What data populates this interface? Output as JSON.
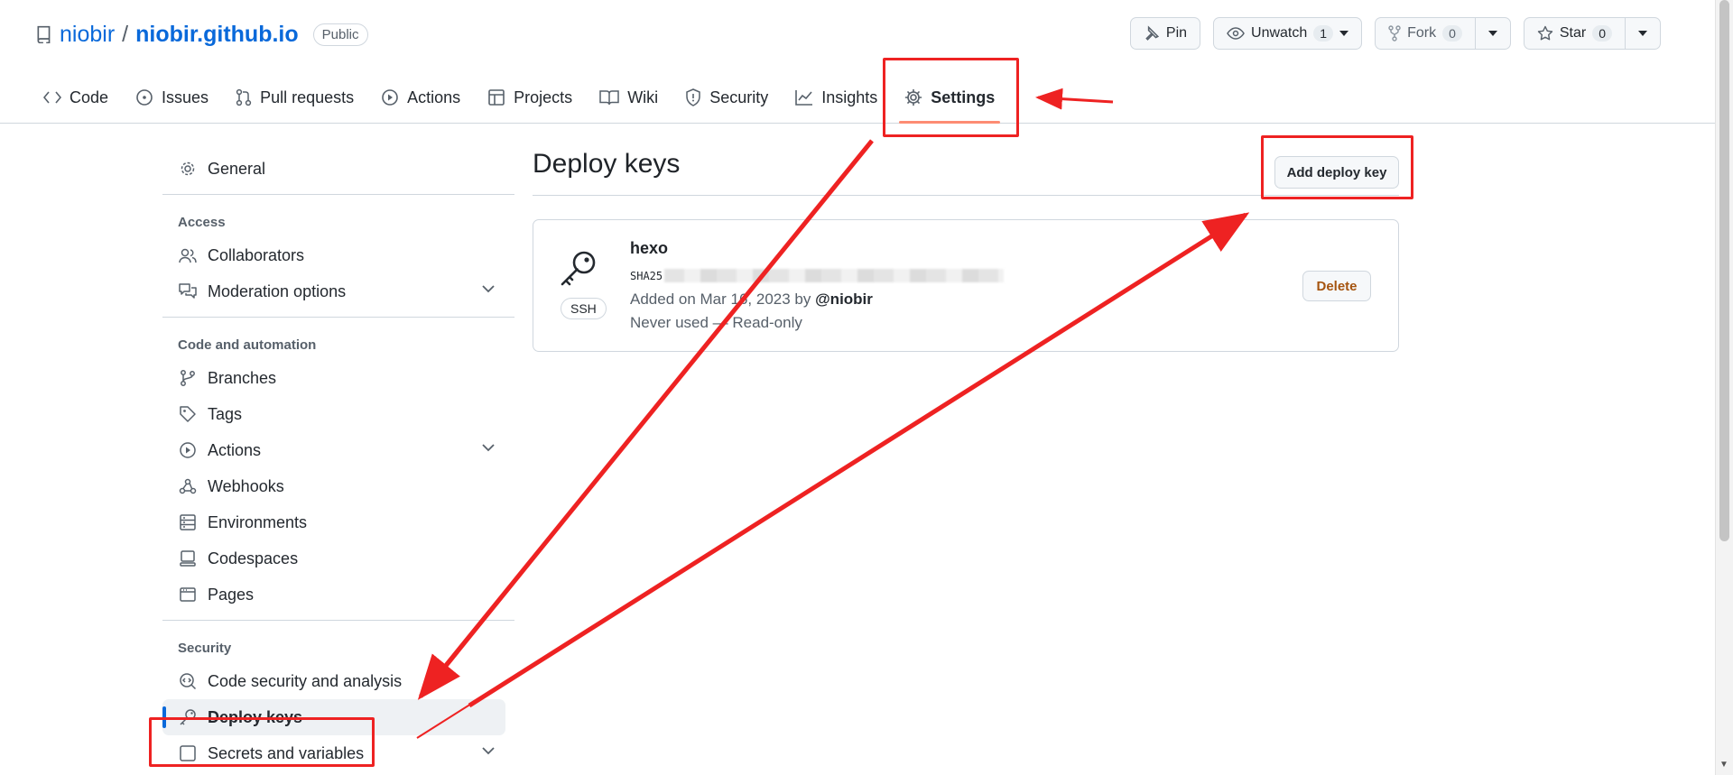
{
  "repo": {
    "owner": "niobir",
    "separator": "/",
    "name": "niobir.github.io",
    "visibility": "Public"
  },
  "repo_actions": {
    "pin": "Pin",
    "unwatch": "Unwatch",
    "watch_count": "1",
    "fork": "Fork",
    "fork_count": "0",
    "star": "Star",
    "star_count": "0"
  },
  "tabs": [
    {
      "label": "Code",
      "icon": "code-icon"
    },
    {
      "label": "Issues",
      "icon": "issue-icon"
    },
    {
      "label": "Pull requests",
      "icon": "pull-request-icon"
    },
    {
      "label": "Actions",
      "icon": "play-icon"
    },
    {
      "label": "Projects",
      "icon": "table-icon"
    },
    {
      "label": "Wiki",
      "icon": "book-icon"
    },
    {
      "label": "Security",
      "icon": "shield-icon"
    },
    {
      "label": "Insights",
      "icon": "graph-icon"
    },
    {
      "label": "Settings",
      "icon": "gear-icon",
      "selected": true
    }
  ],
  "sidebar": {
    "general": "General",
    "access_heading": "Access",
    "collaborators": "Collaborators",
    "moderation": "Moderation options",
    "code_heading": "Code and automation",
    "branches": "Branches",
    "tags": "Tags",
    "actions": "Actions",
    "webhooks": "Webhooks",
    "environments": "Environments",
    "codespaces": "Codespaces",
    "pages": "Pages",
    "security_heading": "Security",
    "code_security": "Code security and analysis",
    "deploy_keys": "Deploy keys",
    "secrets": "Secrets and variables"
  },
  "main": {
    "title": "Deploy keys",
    "add_button": "Add deploy key",
    "key": {
      "name": "hexo",
      "fingerprint_prefix": "SHA25",
      "type_badge": "SSH",
      "added_prefix": "Added on Mar 16, 2023 by",
      "added_by": "@niobir",
      "usage": "Never used — Read-only",
      "delete_label": "Delete"
    }
  },
  "colors": {
    "link": "#0969da",
    "annotation": "#ee2222",
    "danger_text": "#a5540f",
    "tab_underline": "#fd8c73"
  }
}
